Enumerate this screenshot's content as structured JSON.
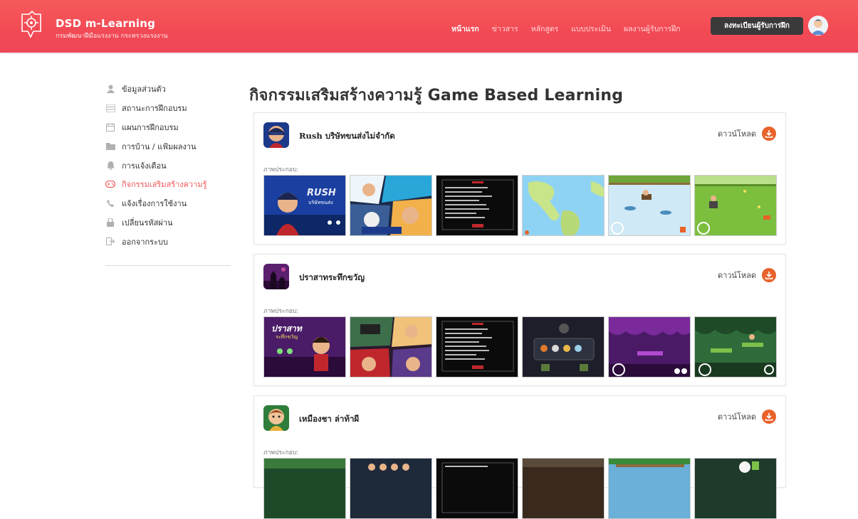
{
  "header": {
    "brand_title": "DSD m-Learning",
    "brand_subtitle": "กรมพัฒนาฝีมือแรงงาน กระทรวงแรงงาน",
    "nav": [
      "หน้าแรก",
      "ข่าวสาร",
      "หลักสูตร",
      "แบบประเมิน",
      "ผลงานผู้รับการฝึก"
    ],
    "register_label": "ลงทะเบียนผู้รับการฝึก"
  },
  "sidebar": {
    "items": [
      {
        "label": "ข้อมูลส่วนตัว",
        "icon": "user-icon"
      },
      {
        "label": "สถานะการฝึกอบรม",
        "icon": "list-icon"
      },
      {
        "label": "แผนการฝึกอบรม",
        "icon": "calendar-icon"
      },
      {
        "label": "การบ้าน / แฟ้มผลงาน",
        "icon": "folder-icon"
      },
      {
        "label": "การแจ้งเตือน",
        "icon": "bell-icon"
      },
      {
        "label": "กิจกรรมเสริมสร้างความรู้",
        "icon": "gamepad-icon",
        "active": true
      },
      {
        "label": "แจ้งเรื่องการใช้งาน",
        "icon": "phone-icon"
      },
      {
        "label": "เปลี่ยนรหัสผ่าน",
        "icon": "lock-icon"
      },
      {
        "label": "ออกจากระบบ",
        "icon": "signout-icon"
      }
    ]
  },
  "main": {
    "title": "กิจกรรมเสริมสร้างความรู้ Game Based Learning",
    "download_label": "ดาวน์โหลด",
    "screenshots_label": "ภาพประกอบ:",
    "games": [
      {
        "name": "Rush บริษัทขนส่งไม่จำกัด",
        "icon_color": "#1c3a8a"
      },
      {
        "name": "ปราสาทระทึกขวัญ",
        "icon_color": "#5b1f6e"
      },
      {
        "name": "เหมืองชา ล่าท้าผี",
        "icon_color": "#2f7d3a"
      }
    ],
    "shot_texts": {
      "rush_logo": "RUSH",
      "rush_sub": "บริษัทขนส่ง",
      "castle_logo": "ปราสาท",
      "castle_sub": "ระทึกขวัญ"
    }
  },
  "colors": {
    "header_red": "#f24a55",
    "active_link": "#f05a5a",
    "download_orange": "#e8622a",
    "register_btn": "#3a3a3a"
  }
}
